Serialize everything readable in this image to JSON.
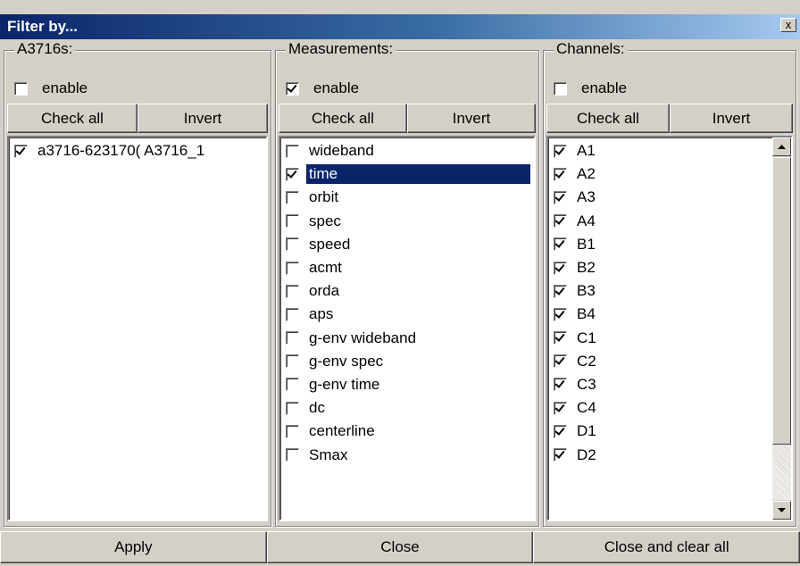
{
  "window": {
    "title": "Filter by...",
    "close_glyph": "x"
  },
  "groups": {
    "a3716s": {
      "legend": "A3716s:",
      "enable_label": "enable",
      "enable_checked": false,
      "check_all_label": "Check all",
      "invert_label": "Invert",
      "items": [
        {
          "label": "a3716-623170( A3716_1",
          "checked": true
        }
      ]
    },
    "measurements": {
      "legend": "Measurements:",
      "enable_label": "enable",
      "enable_checked": true,
      "check_all_label": "Check all",
      "invert_label": "Invert",
      "items": [
        {
          "label": "wideband",
          "checked": false
        },
        {
          "label": "time",
          "checked": true,
          "selected": true
        },
        {
          "label": "orbit",
          "checked": false
        },
        {
          "label": "spec",
          "checked": false
        },
        {
          "label": "speed",
          "checked": false
        },
        {
          "label": "acmt",
          "checked": false
        },
        {
          "label": "orda",
          "checked": false
        },
        {
          "label": "aps",
          "checked": false
        },
        {
          "label": "g-env wideband",
          "checked": false
        },
        {
          "label": "g-env spec",
          "checked": false
        },
        {
          "label": "g-env time",
          "checked": false
        },
        {
          "label": "dc",
          "checked": false
        },
        {
          "label": "centerline",
          "checked": false
        },
        {
          "label": "Smax",
          "checked": false
        }
      ]
    },
    "channels": {
      "legend": "Channels:",
      "enable_label": "enable",
      "enable_checked": false,
      "check_all_label": "Check all",
      "invert_label": "Invert",
      "items": [
        {
          "label": "A1",
          "checked": true
        },
        {
          "label": "A2",
          "checked": true
        },
        {
          "label": "A3",
          "checked": true
        },
        {
          "label": "A4",
          "checked": true
        },
        {
          "label": "B1",
          "checked": true
        },
        {
          "label": "B2",
          "checked": true
        },
        {
          "label": "B3",
          "checked": true
        },
        {
          "label": "B4",
          "checked": true
        },
        {
          "label": "C1",
          "checked": true
        },
        {
          "label": "C2",
          "checked": true
        },
        {
          "label": "C3",
          "checked": true
        },
        {
          "label": "C4",
          "checked": true
        },
        {
          "label": "D1",
          "checked": true
        },
        {
          "label": "D2",
          "checked": true
        }
      ]
    }
  },
  "footer": {
    "apply_label": "Apply",
    "close_label": "Close",
    "close_clear_label": "Close and clear all"
  }
}
